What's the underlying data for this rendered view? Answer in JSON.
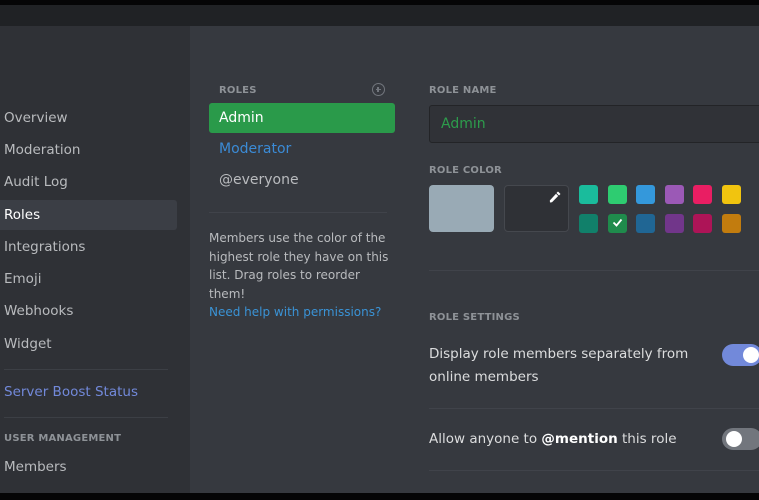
{
  "sidebar": {
    "items": [
      {
        "label": "Overview",
        "active": false
      },
      {
        "label": "Moderation",
        "active": false
      },
      {
        "label": "Audit Log",
        "active": false
      },
      {
        "label": "Roles",
        "active": true
      },
      {
        "label": "Integrations",
        "active": false
      },
      {
        "label": "Emoji",
        "active": false
      },
      {
        "label": "Webhooks",
        "active": false
      },
      {
        "label": "Widget",
        "active": false
      }
    ],
    "boost_label": "Server Boost Status",
    "user_management_header": "USER MANAGEMENT",
    "members_label": "Members"
  },
  "roles": {
    "header": "ROLES",
    "add_icon": "plus-circle-icon",
    "list": [
      {
        "name": "Admin",
        "selected": true,
        "color": "#2a9a4a"
      },
      {
        "name": "Moderator",
        "selected": false,
        "color": "#3b8bd6"
      },
      {
        "name": "@everyone",
        "selected": false,
        "color": "#b9bbbe"
      }
    ],
    "help_text": "Members use the color of the highest role they have on this list. Drag roles to reorder them!",
    "permissions_link": "Need help with permissions?"
  },
  "editor": {
    "role_name_label": "ROLE NAME",
    "role_name_value": "Admin",
    "role_color_label": "ROLE COLOR",
    "default_color": "#99aab5",
    "custom_picker_icon": "eyedropper-icon",
    "swatches": [
      [
        "#1abc9c",
        "#2ecc71",
        "#3498db",
        "#9b59b6",
        "#e91e63",
        "#f1c40f"
      ],
      [
        "#11806a",
        "#1f8b4c",
        "#206694",
        "#71368a",
        "#ad1457",
        "#c27c0e"
      ]
    ],
    "selected_swatch": "#1f8b4c",
    "role_settings_label": "ROLE SETTINGS",
    "settings": [
      {
        "label": "Display role members separately from online members",
        "enabled": true
      },
      {
        "label_before": "Allow anyone to ",
        "label_bold": "@mention",
        "label_after": " this role",
        "enabled": false
      }
    ]
  }
}
